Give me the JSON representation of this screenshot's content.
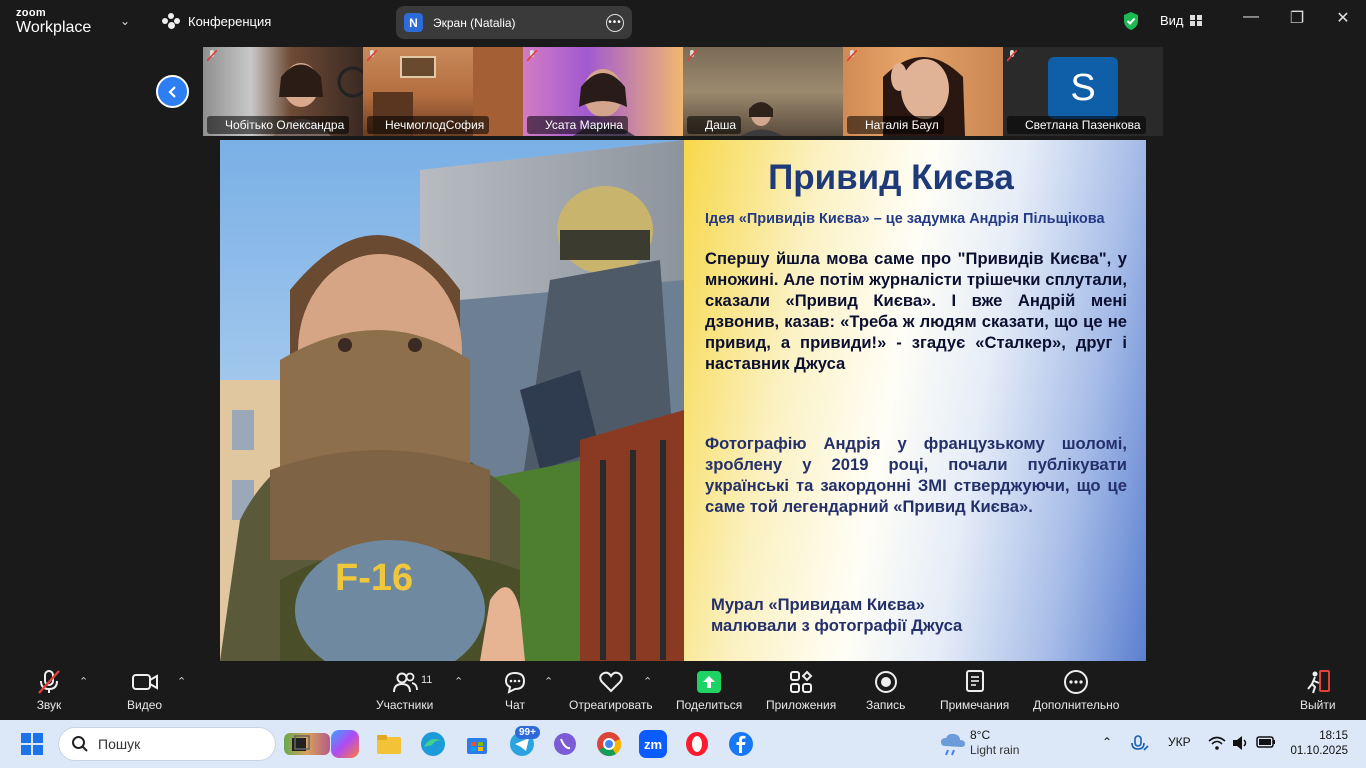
{
  "window": {
    "brand_top": "zoom",
    "brand_bottom": "Workplace",
    "meeting_label": "Конференция",
    "share_title": "Экран (Natalia)",
    "share_badge": "N",
    "view_label": "Вид"
  },
  "participants": [
    {
      "name": "Чобітько Олександра"
    },
    {
      "name": "НечмоглодСофия"
    },
    {
      "name": "Усата Марина"
    },
    {
      "name": "Даша"
    },
    {
      "name": "Наталія Баул"
    },
    {
      "name": "Светлана Пазенкова",
      "avatar_letter": "S"
    }
  ],
  "slide": {
    "title": "Привид Києва",
    "subtitle": "Ідея «Привидів Києва» – це задумка Андрія Пільщікова",
    "paragraph1": "Спершу йшла мова саме про \"Привидів Києва\", у множині. Але потім журналісти трішечки сплутали, сказали «Привид Києва». І вже Андрій мені дзвонив, казав: «Треба ж людям сказати, що це не привид, а привиди!» - згадує «Сталкер», друг і наставник Джуса",
    "paragraph2": "Фотографію Андрія у французькому шоломі, зроблену у 2019 році, почали публікувати українські та закордонні ЗМІ стверджуючи, що це саме той легендарний «Привид Києва».",
    "mural_line1": "Мурал «Привидам Києва»",
    "mural_line2": "малювали з фотографії Джуса",
    "shirt_text": "F-16"
  },
  "controls": {
    "audio": "Звук",
    "video": "Видео",
    "participants": "Участники",
    "participants_count": "11",
    "chat": "Чат",
    "react": "Отреагировать",
    "share": "Поделиться",
    "apps": "Приложения",
    "record": "Запись",
    "notes": "Примечания",
    "more": "Дополнительно",
    "leave": "Выйти"
  },
  "taskbar": {
    "search_placeholder": "Пошук",
    "telegram_badge": "99+",
    "zoom_label": "zm",
    "weather_temp": "8°C",
    "weather_desc": "Light rain",
    "language": "УКР",
    "time": "18:15",
    "date": "01.10.2025"
  },
  "colors": {
    "accent_blue": "#2d7df3",
    "share_green": "#1fd264",
    "muted_red": "#e0413a",
    "shield_green": "#1db954"
  }
}
